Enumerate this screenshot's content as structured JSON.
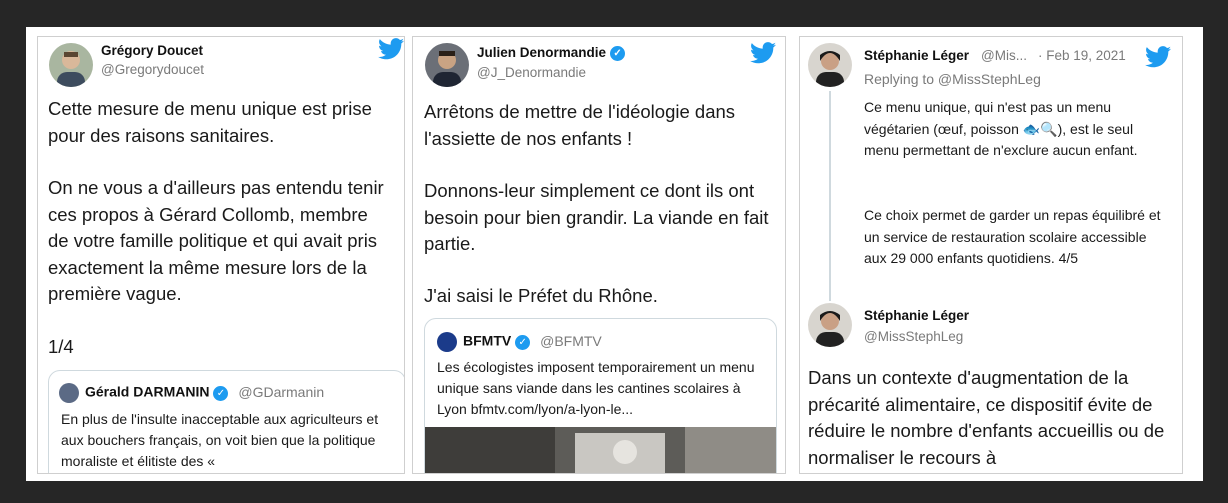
{
  "tweet1": {
    "name": "Grégory Doucet",
    "handle": "@Gregorydoucet",
    "para1": "Cette mesure de menu unique est prise pour des raisons sanitaires.",
    "para2": "On ne vous a d'ailleurs pas entendu tenir ces propos à Gérard Collomb, membre de votre famille politique et qui avait pris exactement la même mesure lors de la première vague.",
    "counter": "1/4",
    "quote": {
      "name": "Gérald DARMANIN",
      "handle": "@GDarmanin",
      "text": "En plus de l'insulte inacceptable aux agriculteurs et aux bouchers français, on voit bien que la politique moraliste et élitiste des «"
    }
  },
  "tweet2": {
    "name": "Julien Denormandie",
    "handle": "@J_Denormandie",
    "para1": "Arrêtons de mettre de l'idéologie dans l'assiette de nos enfants !",
    "para2": "Donnons-leur simplement ce dont ils ont besoin pour bien grandir. La viande en fait partie.",
    "para3": "J'ai saisi le Préfet du Rhône.",
    "quote": {
      "name": "BFMTV",
      "handle": "@BFMTV",
      "text": "Les écologistes imposent temporairement un menu unique sans viande dans les cantines scolaires à Lyon bfmtv.com/lyon/a-lyon-le..."
    }
  },
  "tweet3": {
    "name": "Stéphanie Léger",
    "handle_short": "@Mis...",
    "date": "· Feb 19, 2021",
    "replying": "Replying to @MissStephLeg",
    "reply_p1": "Ce menu unique, qui n'est pas un menu végétarien (œuf, poisson 🐟🔍), est le seul menu permettant de n'exclure aucun enfant.",
    "reply_p2": "Ce choix permet de garder un repas équilibré et un service de restauration scolaire accessible aux 29 000 enfants quotidiens. 4/5",
    "name2": "Stéphanie Léger",
    "handle2": "@MissStephLeg",
    "main_text": "Dans un contexte d'augmentation de la précarité alimentaire, ce dispositif évite de réduire le nombre d'enfants accueillis ou de normaliser le recours à"
  },
  "colors": {
    "twitter_blue": "#1d9bf0",
    "background": "#262626"
  }
}
